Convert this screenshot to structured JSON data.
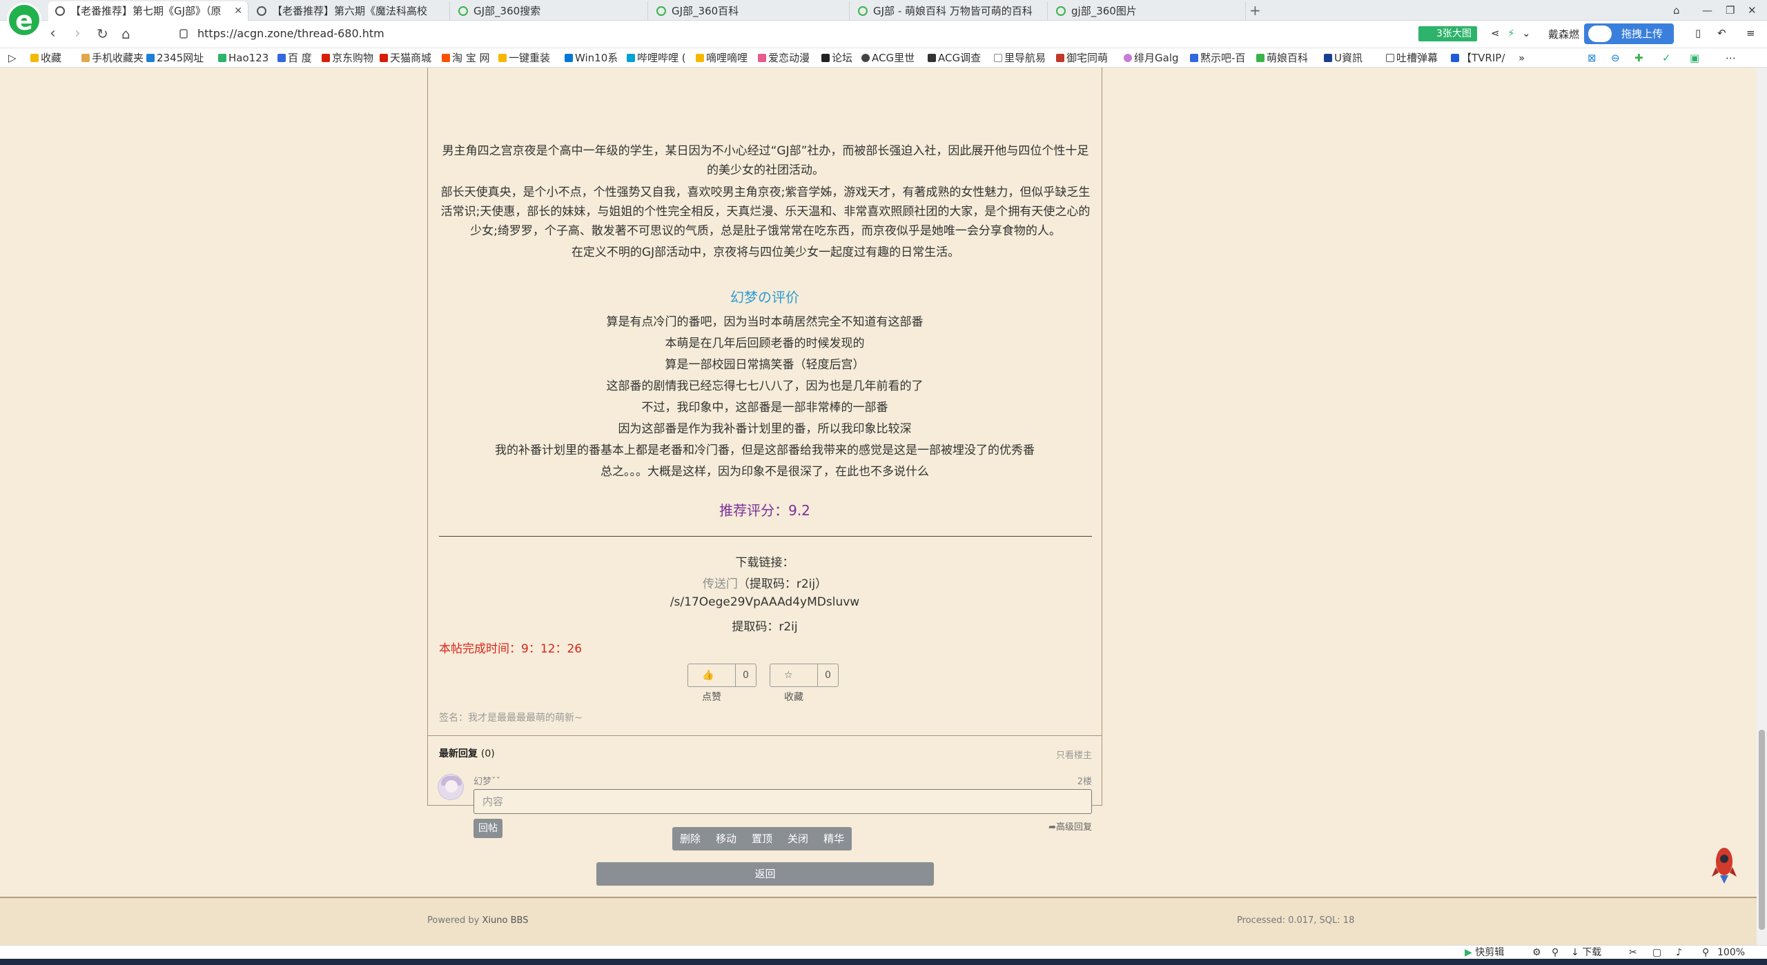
{
  "browser": {
    "logo": "e",
    "tabs": [
      {
        "title": "【老番推荐】第七期《GJ部》（原",
        "active": true
      },
      {
        "title": "【老番推荐】第六期《魔法科高校",
        "active": false
      },
      {
        "title": "GJ部_360搜索",
        "active": false
      },
      {
        "title": "GJ部_360百科",
        "active": false
      },
      {
        "title": "GJ部 - 萌娘百科 万物皆可萌的百科",
        "active": false
      },
      {
        "title": "gj部_360图片",
        "active": false
      }
    ],
    "close_tab": "✕",
    "new_tab": "+",
    "url": "https://acgn.zone/thread-680.htm",
    "pic_badge": "3张大图",
    "search_hint": "戴森燃",
    "upload_label": "拖拽上传",
    "bookmarks": [
      "收藏",
      "手机收藏夹",
      "2345网址",
      "Hao123",
      "百 度",
      "京东购物",
      "天猫商城",
      "淘 宝 网",
      "一键重装",
      "Win10系",
      "哔哩哔哩 (",
      "嘀哩嘀哩",
      "爱恋动漫",
      "论坛",
      "ACG里世",
      "ACG调查",
      "里导航易",
      "御宅同萌",
      "绯月Galg",
      "黙示吧-百",
      "萌娘百科",
      "U資訊",
      "吐槽弹幕",
      "【TVRIP/"
    ],
    "bookmark_more": "»",
    "status": {
      "clip": "快剪辑",
      "download": "下载",
      "zoom": "100%"
    }
  },
  "post": {
    "synopsis": [
      "男主角四之宫京夜是个高中一年级的学生，某日因为不小心经过“GJ部”社办，而被部长强迫入社，因此展开他与四位个性十足的美少女的社团活动。",
      "部长天使真央，是个小不点，个性强势又自我，喜欢咬男主角京夜;紫音学姊，游戏天才，有著成熟的女性魅力，但似乎缺乏生活常识;天使惠，部长的妹妹，与姐姐的个性完全相反，天真烂漫、乐天温和、非常喜欢照顾社团的大家，是个拥有天使之心的少女;绮罗罗，个子高、散发著不可思议的气质，总是肚子饿常常在吃东西，而京夜似乎是她唯一会分享食物的人。",
      "在定义不明的GJ部活动中，京夜将与四位美少女一起度过有趣的日常生活。"
    ],
    "review_title": "幻梦の评价",
    "review_lines": [
      "算是有点冷门的番吧，因为当时本萌居然完全不知道有这部番",
      "本萌是在几年后回顾老番的时候发现的",
      "算是一部校园日常搞笑番（轻度后宫）",
      "这部番的剧情我已经忘得七七八八了，因为也是几年前看的了",
      "不过，我印象中，这部番是一部非常棒的一部番",
      "因为这部番是作为我补番计划里的番，所以我印象比较深",
      "我的补番计划里的番基本上都是老番和冷门番，但是这部番给我带来的感觉是这是一部被埋没了的优秀番",
      "总之。。。大概是这样，因为印象不是很深了，在此也不多说什么"
    ],
    "score": "推荐评分：9.2",
    "download_label": "下载链接：",
    "download_link_text": "传送门",
    "download_code_inline": "（提取码：r2ij）",
    "download_path": "/s/17Oege29VpAAAd4yMDsluvw",
    "download_code": "提取码：r2ij",
    "done_time": "本帖完成时间：9：12：26",
    "like_label": "点赞",
    "like_count": "0",
    "fav_label": "收藏",
    "fav_count": "0",
    "signature": "签名：我才是最最最最萌的萌新~"
  },
  "reply": {
    "header": "最新回复",
    "count": "(0)",
    "only_op": "只看楼主",
    "user": "幻梦ˇˇ",
    "floor": "2楼",
    "placeholder": "内容",
    "submit": "回帖",
    "advanced": "高级回复"
  },
  "admin": {
    "buttons": [
      "删除",
      "移动",
      "置顶",
      "关闭",
      "精华"
    ],
    "back": "返回"
  },
  "footer": {
    "powered_prefix": "Powered by",
    "powered_name": "Xiuno BBS",
    "processed": "Processed: 0.017, SQL: 18"
  }
}
